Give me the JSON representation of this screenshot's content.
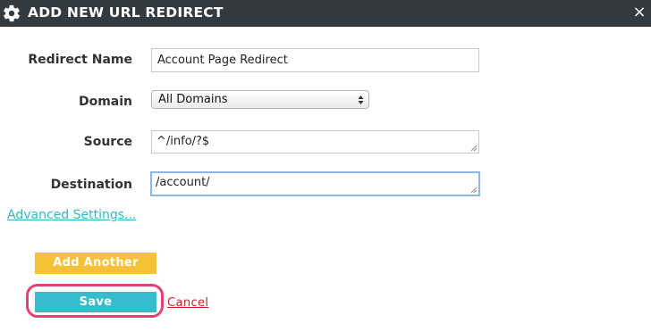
{
  "header": {
    "title": "ADD NEW URL REDIRECT",
    "close_label": "×",
    "icon": "gear-icon"
  },
  "form": {
    "redirect_name": {
      "label": "Redirect Name",
      "value": "Account Page Redirect"
    },
    "domain": {
      "label": "Domain",
      "selected": "All Domains"
    },
    "source": {
      "label": "Source",
      "value": "^/info/?$"
    },
    "destination": {
      "label": "Destination",
      "value": "/account/"
    }
  },
  "advanced_link": "Advanced Settings...",
  "buttons": {
    "add_another": "Add Another",
    "save": "Save",
    "cancel": "Cancel"
  },
  "colors": {
    "header_bg": "#333b40",
    "add_button": "#f5c136",
    "save_button": "#36bccd",
    "highlight": "#e2427a",
    "cancel_link": "#cc1f1f",
    "link": "#35b3c7"
  }
}
